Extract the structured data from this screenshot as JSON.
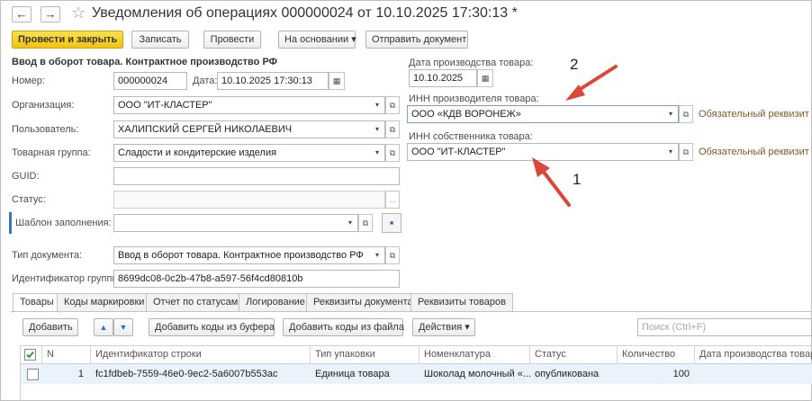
{
  "window": {
    "title": "Уведомления об операциях 000000024 от 10.10.2025 17:30:13 *",
    "back_icon": "←",
    "forward_icon": "→",
    "star_icon": "☆"
  },
  "toolbar": {
    "post_and_close": "Провести и закрыть",
    "save": "Записать",
    "post": "Провести",
    "based_on": "На основании",
    "send_document": "Отправить документ"
  },
  "form": {
    "heading": "Ввод в оборот товара. Контрактное производство РФ",
    "number_label": "Номер:",
    "number_value": "000000024",
    "date_label": "Дата:",
    "date_value": "10.10.2025 17:30:13",
    "organization_label": "Организация:",
    "organization_value": "ООО \"ИТ-КЛАСТЕР\"",
    "user_label": "Пользователь:",
    "user_value": "ХАЛИПСКИЙ СЕРГЕЙ НИКОЛАЕВИЧ",
    "product_group_label": "Товарная группа:",
    "product_group_value": "Сладости и кондитерские изделия",
    "guid_label": "GUID:",
    "guid_value": "",
    "status_label": "Статус:",
    "status_value": "",
    "template_label": "Шаблон заполнения:",
    "template_value": "",
    "doc_type_label": "Тип документа:",
    "doc_type_value": "Ввод в оборот товара. Контрактное производство РФ",
    "group_id_label": "Идентификатор группы:",
    "group_id_value": "8699dc08-0c2b-47b8-a597-56f4cd80810b",
    "production_date_label": "Дата производства товара:",
    "production_date_value": "10.10.2025",
    "producer_inn_label": "ИНН производителя товара:",
    "producer_inn_value": "ООО «КДВ ВОРОНЕЖ»",
    "owner_inn_label": "ИНН собственника товара:",
    "owner_inn_value": "ООО \"ИТ-КЛАСТЕР\"",
    "required_hint": "Обязательный реквизит",
    "dropdown_icon": "▾",
    "open_icon": "⧉",
    "calendar_icon": "▦",
    "ellipsis": "...",
    "save_icon": "▪"
  },
  "annotations": {
    "marker_1": "1",
    "marker_2": "2",
    "arrow_color": "#d9483b"
  },
  "tabs": [
    "Товары",
    "Коды маркировки",
    "Отчет по статусам",
    "Логирование",
    "Реквизиты документа",
    "Реквизиты товаров"
  ],
  "table_toolbar": {
    "add": "Добавить",
    "up_icon": "▲",
    "down_icon": "▼",
    "add_from_buffer": "Добавить коды из буфера",
    "add_from_file": "Добавить коды из файла",
    "actions": "Действия",
    "search_placeholder": "Поиск (Ctrl+F)"
  },
  "table": {
    "columns": [
      "N",
      "Идентификатор строки",
      "Тип упаковки",
      "Номенклатура",
      "Статус",
      "Количество",
      "Дата производства товара"
    ],
    "rows": [
      {
        "n": "1",
        "row_id": "fc1fdbeb-7559-46e0-9ec2-5a6007b553ac",
        "package_type": "Единица товара",
        "nomenclature": "Шоколад молочный «...",
        "status": "опубликована",
        "quantity": "100",
        "production_date": ""
      }
    ]
  },
  "colors": {
    "accent_yellow": "#f1c30f",
    "selected_row": "#eaf2fb",
    "required_hint": "#7a5a2a"
  }
}
